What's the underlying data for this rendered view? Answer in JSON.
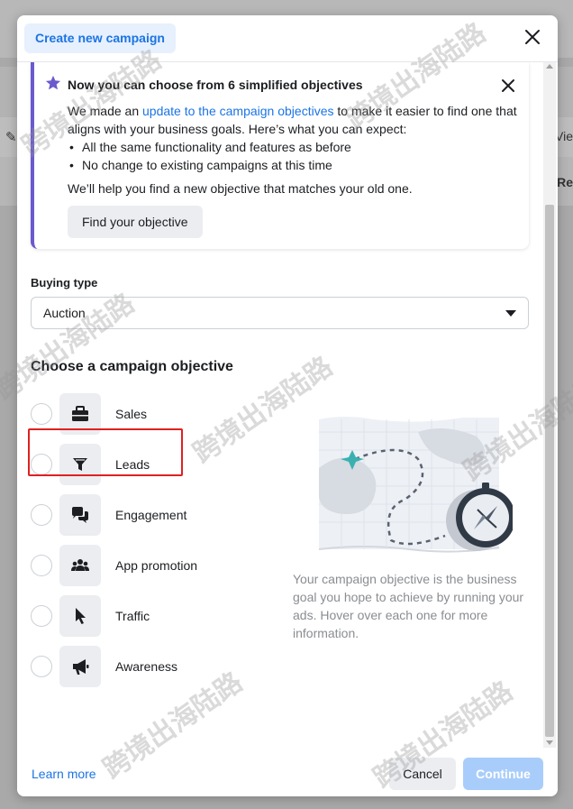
{
  "background": {
    "right_text_1": "Vie",
    "right_text_2": "Re"
  },
  "modal": {
    "tab_title": "Create new campaign",
    "close_icon": "close-icon"
  },
  "notice": {
    "title": "Now you can choose from 6 simplified objectives",
    "body_prefix": "We made an ",
    "body_link": "update to the campaign objectives",
    "body_suffix": " to make it easier to find one that aligns with your business goals. Here’s what you can expect:",
    "bullets": [
      "All the same functionality and features as before",
      "No change to existing campaigns at this time"
    ],
    "help_text": "We’ll help you find a new objective that matches your old one.",
    "find_button": "Find your objective",
    "accent_color": "#6a5acd"
  },
  "buying_type": {
    "label": "Buying type",
    "selected": "Auction"
  },
  "objectives": {
    "heading": "Choose a campaign objective",
    "items": [
      {
        "label": "Sales",
        "icon": "briefcase-icon"
      },
      {
        "label": "Leads",
        "icon": "funnel-icon",
        "highlighted": true
      },
      {
        "label": "Engagement",
        "icon": "chat-bubbles-icon"
      },
      {
        "label": "App promotion",
        "icon": "people-icon"
      },
      {
        "label": "Traffic",
        "icon": "cursor-icon"
      },
      {
        "label": "Awareness",
        "icon": "megaphone-icon"
      }
    ],
    "description": "Your campaign objective is the business goal you hope to achieve by running your ads. Hover over each one for more information."
  },
  "footer": {
    "learn_more": "Learn more",
    "cancel": "Cancel",
    "continue": "Continue"
  },
  "colors": {
    "link": "#1b74e4",
    "highlight_border": "#e02020",
    "continue_disabled": "#a9cdfa"
  },
  "watermark": "跨境出海陆路"
}
